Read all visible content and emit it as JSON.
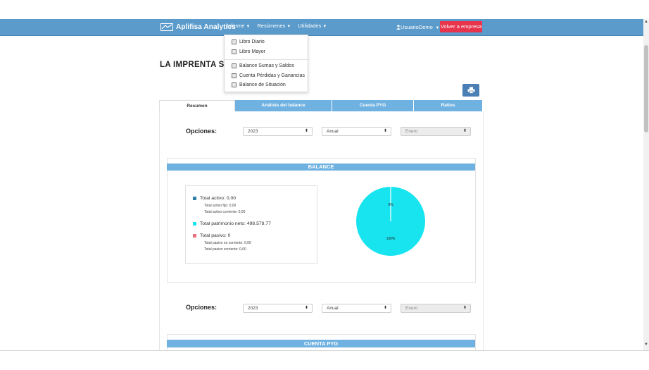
{
  "navbar": {
    "brand": "Aplifisa Analytics",
    "menu": [
      "Informe",
      "Resúmenes",
      "Utilidades"
    ],
    "user": "UsuarioDemo",
    "back_button": "Volver a empresa",
    "color": "#5b9bcb"
  },
  "dropdown": {
    "items": [
      "Libro Diario",
      "Libro Mayor",
      "Balance Sumas y Saldos",
      "Cuenta Pérdidas y Ganancias",
      "Balance de Situación"
    ]
  },
  "page": {
    "title": "LA IMPRENTA SL"
  },
  "tabs": [
    "Resumen",
    "Análisis del balance",
    "Cuenta PYG",
    "Ratios"
  ],
  "options_block_1": {
    "label": "Opciones:",
    "year": "2023",
    "period": "Anual",
    "month": "Enero"
  },
  "balance": {
    "header": "BALANCE",
    "legend": {
      "activo": {
        "label": "Total activo: 0,00",
        "color": "#2e7fa8"
      },
      "activo_fijo": "Total activo fijo: 0,00",
      "activo_corriente": "Total activo corriente: 0,00",
      "patrimonio": {
        "label": "Total patrimonio neto: 498.578,77",
        "color": "#18e4f0"
      },
      "pasivo": {
        "label": "Total pasivo: 0",
        "color": "#e9707b"
      },
      "pasivo_no_corriente": "Total pasivo no corriente: 0,00",
      "pasivo_corriente": "Total pasivo corriente: 0,00"
    }
  },
  "chart_data": {
    "type": "pie",
    "slices": [
      {
        "label": "0%",
        "value": 0,
        "color": "#2e7fa8"
      },
      {
        "label": "100%",
        "value": 100,
        "color": "#18e4f0"
      }
    ]
  },
  "options_block_2": {
    "label": "Opciones:",
    "year": "2023",
    "period": "Anual",
    "month": "Enero"
  },
  "pyg": {
    "header": "CUENTA PYG"
  }
}
